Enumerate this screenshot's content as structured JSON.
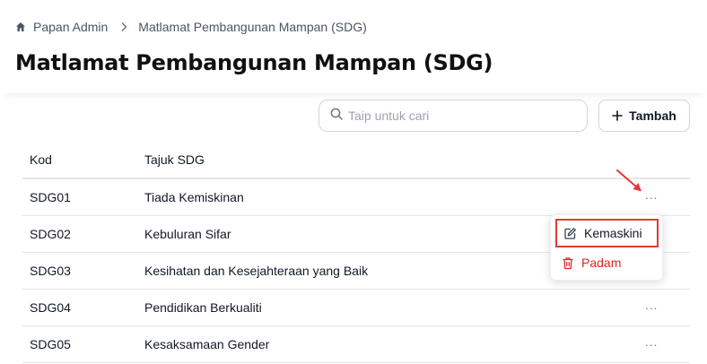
{
  "breadcrumb": {
    "home": "Papan Admin",
    "current": "Matlamat Pembangunan Mampan (SDG)"
  },
  "page_title": "Matlamat Pembangunan Mampan (SDG)",
  "search": {
    "placeholder": "Taip untuk cari",
    "value": ""
  },
  "add_button": {
    "label": "Tambah"
  },
  "table": {
    "headers": {
      "kod": "Kod",
      "tajuk": "Tajuk SDG"
    },
    "rows": [
      {
        "kod": "SDG01",
        "tajuk": "Tiada Kemiskinan"
      },
      {
        "kod": "SDG02",
        "tajuk": "Kebuluran Sifar"
      },
      {
        "kod": "SDG03",
        "tajuk": "Kesihatan dan Kesejahteraan yang Baik"
      },
      {
        "kod": "SDG04",
        "tajuk": "Pendidikan Berkualiti"
      },
      {
        "kod": "SDG05",
        "tajuk": "Kesaksamaan Gender"
      }
    ],
    "more_label": "···"
  },
  "row_menu": {
    "edit_label": "Kemaskini",
    "delete_label": "Padam"
  },
  "icons": {
    "home": "home-icon",
    "breadcrumb_separator": "chevron-right-icon",
    "search": "search-icon",
    "add": "plus-icon",
    "edit": "edit-icon",
    "delete": "trash-icon",
    "annotation": "red-arrow-icon"
  },
  "colors": {
    "danger": "#dc2626",
    "highlight": "#e53935",
    "border": "#e5e7eb",
    "text": "#111827"
  }
}
